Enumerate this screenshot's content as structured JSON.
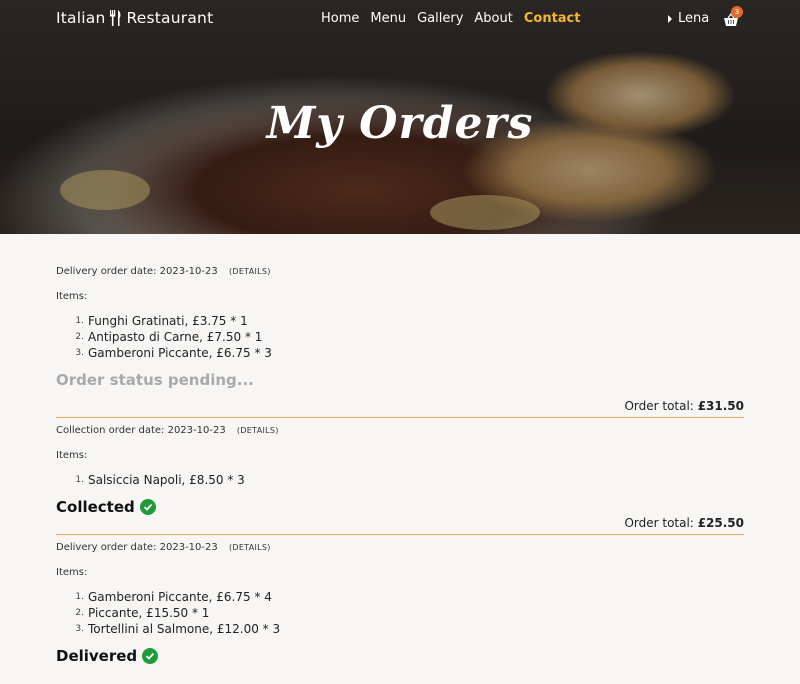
{
  "nav": {
    "brand_left": "Italian",
    "brand_right": "Restaurant",
    "links": [
      "Home",
      "Menu",
      "Gallery",
      "About",
      "Contact"
    ],
    "active_link": "Contact",
    "user_name": "Lena",
    "cart_count": "3"
  },
  "hero": {
    "title": "My Orders"
  },
  "orders": [
    {
      "type_date": "Delivery order date: 2023-10-23",
      "details_label": "(DETAILS)",
      "items_label": "Items:",
      "items": [
        "Funghi Gratinati, £3.75 * 1",
        "Antipasto di Carne, £7.50 * 1",
        "Gamberoni Piccante, £6.75 * 3"
      ],
      "status": "Order status pending...",
      "status_kind": "pending",
      "total_label": "Order total:",
      "total_value": "£31.50"
    },
    {
      "type_date": "Collection order date: 2023-10-23",
      "details_label": "(DETAILS)",
      "items_label": "Items:",
      "items": [
        "Salsiccia Napoli, £8.50 * 3"
      ],
      "status": "Collected",
      "status_kind": "done",
      "total_label": "Order total:",
      "total_value": "£25.50"
    },
    {
      "type_date": "Delivery order date: 2023-10-23",
      "details_label": "(DETAILS)",
      "items_label": "Items:",
      "items": [
        "Gamberoni Piccante, £6.75 * 4",
        "Piccante, £15.50 * 1",
        "Tortellini al Salmone, £12.00 * 3"
      ],
      "status": "Delivered",
      "status_kind": "done"
    }
  ],
  "colors": {
    "accent": "#f5b731",
    "divider": "#e6b556",
    "success": "#1f9b3b",
    "badge": "#e06a2d"
  }
}
